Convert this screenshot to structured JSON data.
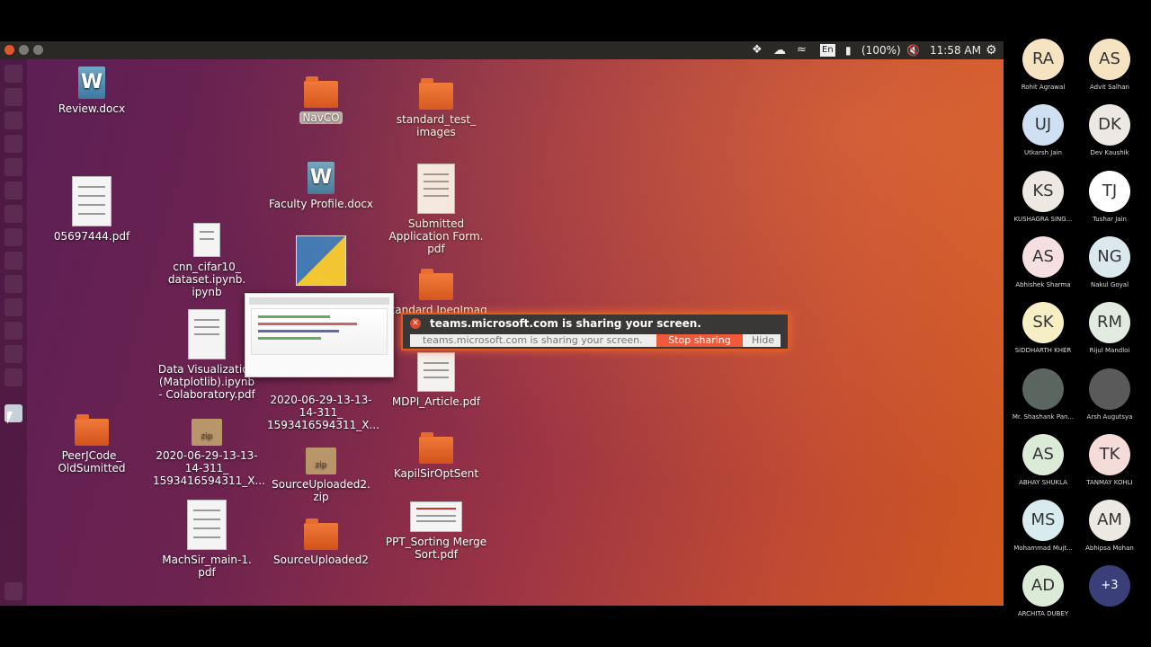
{
  "topbar": {
    "lang": "En",
    "battery": "(100%)",
    "time": "11:58 AM"
  },
  "desktop": {
    "icons": [
      {
        "label": "Review.docx"
      },
      {
        "label": "NavCO"
      },
      {
        "label": "standard_test_\nimages"
      },
      {
        "label": "Faculty Profile.docx"
      },
      {
        "label": "Submitted\nApplication Form.\npdf"
      },
      {
        "label": "05697444.pdf"
      },
      {
        "label": "cnn_cifar10_\ndataset.ipynb.\nipynb"
      },
      {
        "label": "Data Visualization\n(Matplotlib).ipynb\n- Colaboratory.pdf"
      },
      {
        "label": "2020-06-29-13-13-\n14-311_\n1593416594311_X..."
      },
      {
        "label": "MDPI_Article.pdf"
      },
      {
        "label": "PeerJCode_\nOldSumitted"
      },
      {
        "label": "2020-06-29-13-13-\n14-311_\n1593416594311_X..."
      },
      {
        "label": "SourceUploaded2.\nzip"
      },
      {
        "label": "KapilSirOptSent"
      },
      {
        "label": "MachSir_main-1.\npdf"
      },
      {
        "label": "SourceUploaded2"
      },
      {
        "label": "PPT_Sorting Merge\nSort.pdf"
      },
      {
        "label": "standard JpegImag"
      },
      {
        "label": "zip"
      },
      {
        "label": "zip"
      }
    ]
  },
  "banner": {
    "message": "teams.microsoft.com is sharing your screen.",
    "under_text": "teams.microsoft.com is sharing your screen.",
    "stop_label": "Stop sharing",
    "hide_label": "Hide"
  },
  "participants": [
    {
      "initials": "RA",
      "name": "Rohit Agrawal",
      "color": "#f6e3c1"
    },
    {
      "initials": "AS",
      "name": "Advit Salhan",
      "color": "#f6e3c1"
    },
    {
      "initials": "UJ",
      "name": "Utkarsh Jain",
      "color": "#cfe0f2"
    },
    {
      "initials": "DK",
      "name": "Dev Kaushik",
      "color": "#ede8e2"
    },
    {
      "initials": "KS",
      "name": "KUSHAGRA SING...",
      "color": "#ede8e2"
    },
    {
      "initials": "TJ",
      "name": "Tushar Jain",
      "color": "#ffffff"
    },
    {
      "initials": "AS",
      "name": "Abhishek Sharma",
      "color": "#f6dfe0"
    },
    {
      "initials": "NG",
      "name": "Nakul Goyal",
      "color": "#dbe9ee"
    },
    {
      "initials": "SK",
      "name": "SIDDHARTH KHER",
      "color": "#f6efc5"
    },
    {
      "initials": "RM",
      "name": "Rijul Mandloi",
      "color": "#e1ebdf"
    },
    {
      "initials": "",
      "name": "Mr. Shashank Pan...",
      "color": "#5b6660"
    },
    {
      "initials": "",
      "name": "Arsh Augutsya",
      "color": "#5a5a5a"
    },
    {
      "initials": "AS",
      "name": "ABHAY SHUKLA",
      "color": "#dcead8"
    },
    {
      "initials": "TK",
      "name": "TANMAY KOHLI",
      "color": "#f6dcd8"
    },
    {
      "initials": "MS",
      "name": "Mohammad Mujt...",
      "color": "#d8ecef"
    },
    {
      "initials": "AM",
      "name": "Abhipsa Mohan",
      "color": "#ede8e2"
    },
    {
      "initials": "AD",
      "name": "ARCHITA DUBEY",
      "color": "#dcead8"
    },
    {
      "initials": "+3",
      "name": "",
      "color": "#3a3f7a"
    }
  ]
}
